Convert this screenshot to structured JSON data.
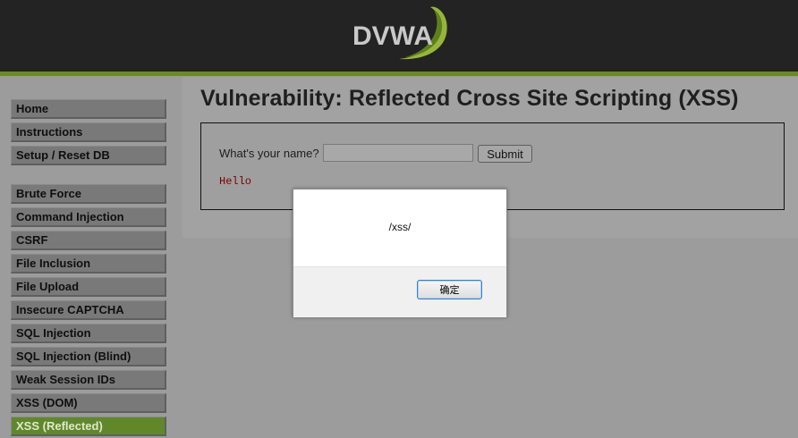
{
  "header": {
    "logo_text": "DVWA",
    "colors": {
      "header_bg": "#232323",
      "accent": "#6c8b1e"
    }
  },
  "menu": {
    "items": [
      {
        "label": "Home",
        "selected": false
      },
      {
        "label": "Instructions",
        "selected": false
      },
      {
        "label": "Setup / Reset DB",
        "selected": false
      },
      {
        "label": "Brute Force",
        "selected": false
      },
      {
        "label": "Command Injection",
        "selected": false
      },
      {
        "label": "CSRF",
        "selected": false
      },
      {
        "label": "File Inclusion",
        "selected": false
      },
      {
        "label": "File Upload",
        "selected": false
      },
      {
        "label": "Insecure CAPTCHA",
        "selected": false
      },
      {
        "label": "SQL Injection",
        "selected": false
      },
      {
        "label": "SQL Injection (Blind)",
        "selected": false
      },
      {
        "label": "Weak Session IDs",
        "selected": false
      },
      {
        "label": "XSS (DOM)",
        "selected": false
      },
      {
        "label": "XSS (Reflected)",
        "selected": true
      }
    ]
  },
  "main": {
    "title": "Vulnerability: Reflected Cross Site Scripting (XSS)",
    "form": {
      "label": "What's your name?",
      "input_value": "",
      "submit_label": "Submit"
    },
    "output": "Hello"
  },
  "dialog": {
    "message": "/xss/",
    "ok_label": "确定"
  }
}
